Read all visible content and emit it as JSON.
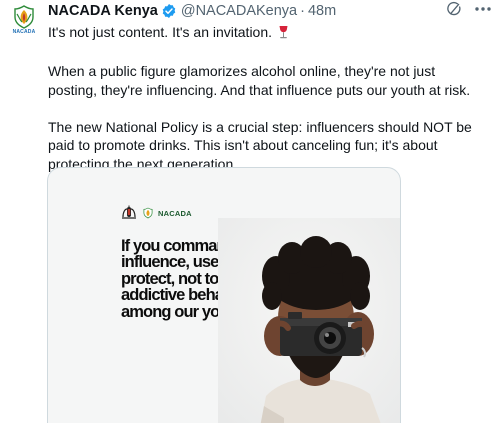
{
  "tweet": {
    "author_name": "NACADA Kenya",
    "handle": "@NACADAKenya",
    "separator": "·",
    "time": "48m",
    "avatar_label": "NACADA",
    "paragraphs": [
      "It's not just content. It's an invitation.",
      "When a public figure glamorizes alcohol online, they're not just posting, they're influencing. And that influence puts our youth at risk.",
      "The new National Policy is a crucial step: influencers should NOT be paid to promote drinks. This isn't about canceling fun; it's about protecting the next generation."
    ],
    "verified_color": "#1d9bf0",
    "icons": [
      "verified-badge-icon",
      "grok-icon",
      "more-icon",
      "wine-glass-icon"
    ]
  },
  "media": {
    "logo_text": "NACADA",
    "quote": "If you command influence, use it to protect, not to normalize addictive behaviors among our youth.”"
  }
}
